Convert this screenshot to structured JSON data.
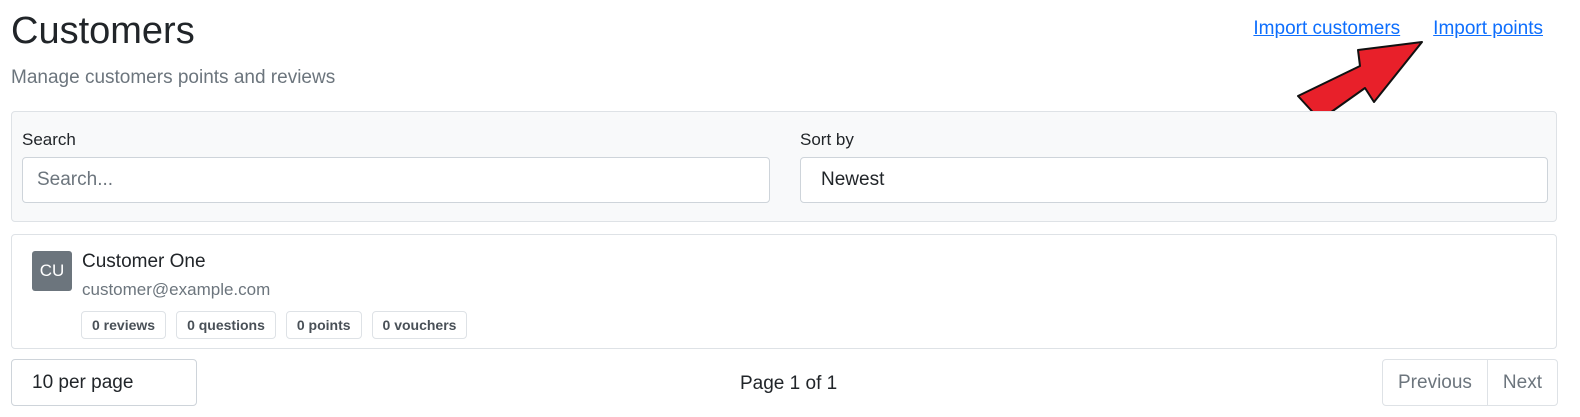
{
  "header": {
    "title": "Customers",
    "subtitle": "Manage customers points and reviews",
    "links": {
      "import_customers": "Import customers",
      "import_points": "Import points"
    }
  },
  "annotation": {
    "arrow_color": "#e8202a",
    "icon": "red-arrow-icon"
  },
  "filters": {
    "search_label": "Search",
    "search_placeholder": "Search...",
    "search_value": "",
    "sort_label": "Sort by",
    "sort_value": "Newest"
  },
  "customers": [
    {
      "initials": "CU",
      "name": "Customer One",
      "email": "customer@example.com",
      "badges": {
        "reviews": "0 reviews",
        "questions": "0 questions",
        "points": "0 points",
        "vouchers": "0 vouchers"
      }
    }
  ],
  "pagination": {
    "per_page": "10 per page",
    "page_info": "Page 1 of 1",
    "previous": "Previous",
    "next": "Next"
  }
}
